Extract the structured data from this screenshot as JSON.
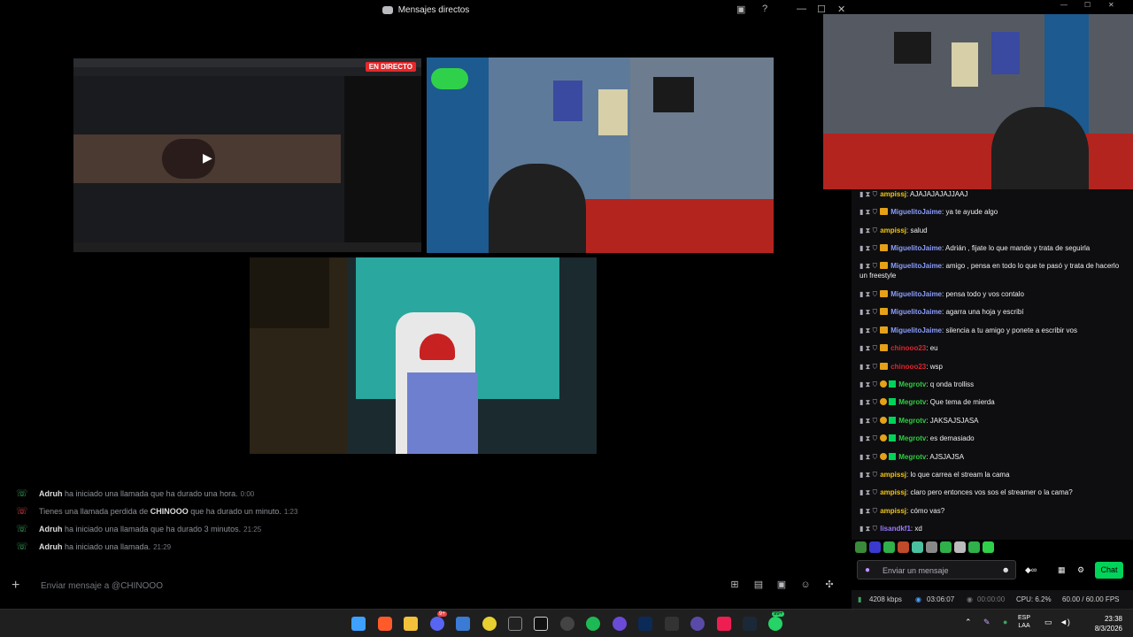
{
  "discord": {
    "title": "Mensajes directos",
    "live_badge": "EN DIRECTO",
    "call_log": [
      {
        "user": "Adruh",
        "text": " ha iniciado una llamada que ha durado una hora.",
        "time": "0:00"
      },
      {
        "prefix": "Tienes una llamada perdida de ",
        "user": "CHINOOO",
        "text": " que ha durado un minuto.",
        "time": "1:23"
      },
      {
        "user": "Adruh",
        "text": " ha iniciado una llamada que ha durado 3 minutos.",
        "time": "21:25"
      },
      {
        "user": "Adruh",
        "text": " ha iniciado una llamada.",
        "time": "21:29"
      }
    ],
    "message_placeholder": "Enviar mensaje a @CHINOOO"
  },
  "chat": {
    "messages": [
      {
        "user": "ampissj",
        "color": "#f0c419",
        "text": "AJAJAJAJAJJAAJ",
        "badge": "none"
      },
      {
        "user": "MiguelitoJaime",
        "color": "#8a9dff",
        "text": "ya te ayude algo",
        "badge": "crown"
      },
      {
        "user": "ampissj",
        "color": "#f0c419",
        "text": "salud",
        "badge": "none"
      },
      {
        "user": "MiguelitoJaime",
        "color": "#8a9dff",
        "text": "Adrián , fijate lo que mande y trata de seguirla",
        "badge": "crown"
      },
      {
        "user": "MiguelitoJaime",
        "color": "#8a9dff",
        "text": "amigo , pensa en todo lo que te pasó y trata de hacerlo un freestyle",
        "badge": "crown"
      },
      {
        "user": "MiguelitoJaime",
        "color": "#8a9dff",
        "text": "pensa todo y vos contalo",
        "badge": "crown"
      },
      {
        "user": "MiguelitoJaime",
        "color": "#8a9dff",
        "text": "agarra una hoja y escribí",
        "badge": "crown"
      },
      {
        "user": "MiguelitoJaime",
        "color": "#8a9dff",
        "text": "silencia a tu amigo y ponete a escribir vos",
        "badge": "crown"
      },
      {
        "user": "chinooo23",
        "color": "#e0242d",
        "text": "eu",
        "badge": "crown"
      },
      {
        "user": "chinooo23",
        "color": "#e0242d",
        "text": "wsp",
        "badge": "crown"
      },
      {
        "user": "Megrotv",
        "color": "#2ecc40",
        "text": "q onda trolliss",
        "badge": "coin"
      },
      {
        "user": "Megrotv",
        "color": "#2ecc40",
        "text": "Que tema de mierda",
        "badge": "coin"
      },
      {
        "user": "Megrotv",
        "color": "#2ecc40",
        "text": "JAKSAJSJASA",
        "badge": "coin"
      },
      {
        "user": "Megrotv",
        "color": "#2ecc40",
        "text": "es demasiado",
        "badge": "coin"
      },
      {
        "user": "Megrotv",
        "color": "#2ecc40",
        "text": "AJSJAJSA",
        "badge": "coin"
      },
      {
        "user": "ampissj",
        "color": "#f0c419",
        "text": "lo que carrea el stream la cama",
        "badge": "none"
      },
      {
        "user": "ampissj",
        "color": "#f0c419",
        "text": "claro pero entonces vos sos el streamer o la cama?",
        "badge": "none"
      },
      {
        "user": "ampissj",
        "color": "#f0c419",
        "text": "cómo vas?",
        "badge": "none"
      },
      {
        "user": "lisandkf1",
        "color": "#9b7bff",
        "text": "xd",
        "badge": "none"
      }
    ],
    "input_placeholder": "Enviar un mensaje",
    "chat_button": "Chat"
  },
  "stats": {
    "bitrate": "4208 kbps",
    "live_time": "03:06:07",
    "rec_time": "00:00:00",
    "cpu": "CPU: 6.2%",
    "fps": "60.00 / 60.00 FPS"
  },
  "taskbar": {
    "lang": "ESP",
    "lang2": "LAA",
    "time": "23:38",
    "date": "8/3/2026",
    "discord_badge": "9+",
    "whatsapp_badge": "99+"
  }
}
